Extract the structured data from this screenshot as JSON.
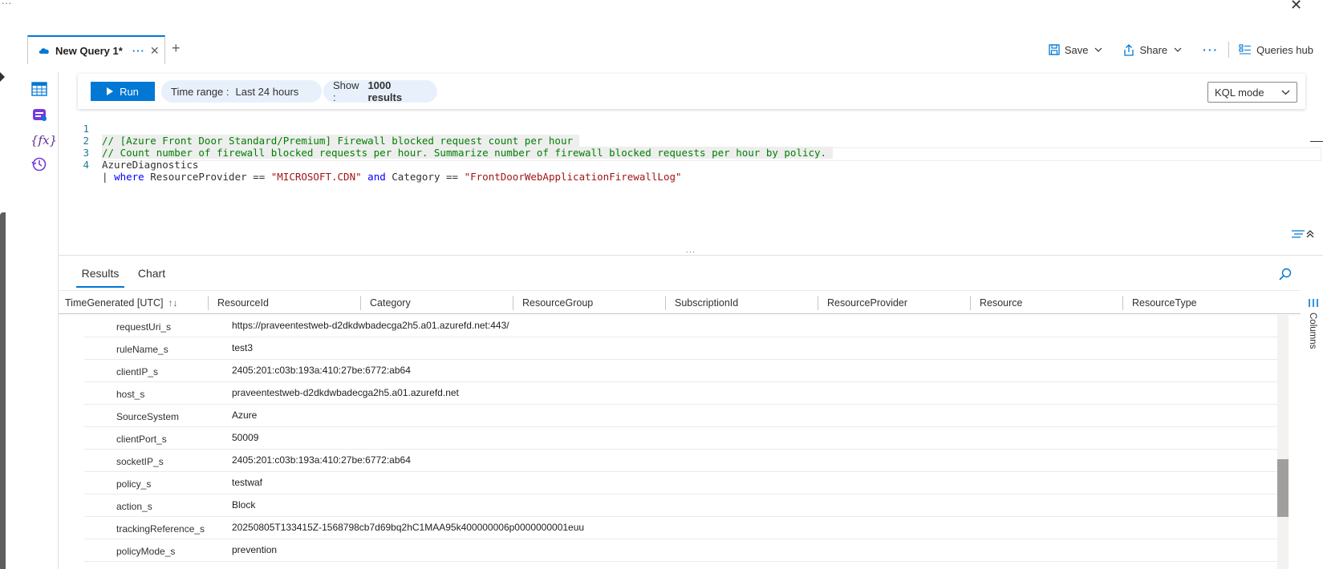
{
  "window": {
    "top_dots": "...",
    "close_glyph": "✕"
  },
  "tabs": [
    {
      "label": "New Query 1*",
      "more": "···",
      "close": "✕"
    }
  ],
  "add_tab": "+",
  "toolbar": {
    "save_label": "Save",
    "share_label": "Share",
    "more": "···",
    "queries_hub_label": "Queries hub"
  },
  "query_toolbar": {
    "run_label": "Run",
    "time_range_label": "Time range :",
    "time_range_value": "Last 24 hours",
    "show_label": "Show :",
    "show_value": "1000 results",
    "mode_value": "KQL mode"
  },
  "rail_icons": [
    "tables-icon",
    "queries-icon",
    "functions-icon",
    "history-icon"
  ],
  "rail_fx": "{fx}",
  "editor": {
    "lines": [
      {
        "num": "1",
        "text": "// [Azure Front Door Standard/Premium] Firewall blocked request count per hour "
      },
      {
        "num": "2",
        "text": "// Count number of firewall blocked requests per hour. Summarize number of firewall blocked requests per hour by policy. "
      },
      {
        "num": "3",
        "text": "AzureDiagnostics"
      },
      {
        "num": "4",
        "pipe": "| ",
        "kw1": "where",
        "mid1": " ResourceProvider == ",
        "str1": "\"MICROSOFT.CDN\"",
        "kw2": " and",
        "mid2": " Category == ",
        "str2": "\"FrontDoorWebApplicationFirewallLog\""
      }
    ]
  },
  "splitter": "···",
  "results_tabs": {
    "results_label": "Results",
    "chart_label": "Chart"
  },
  "columns": [
    "TimeGenerated [UTC]",
    "ResourceId",
    "Category",
    "ResourceGroup",
    "SubscriptionId",
    "ResourceProvider",
    "Resource",
    "ResourceType"
  ],
  "sort_glyph": "↑↓",
  "columns_panel_label": "Columns",
  "rows": [
    {
      "key": "requestUri_s",
      "value": "https://praveentestweb-d2dkdwbadecga2h5.a01.azurefd.net:443/"
    },
    {
      "key": "ruleName_s",
      "value": "test3"
    },
    {
      "key": "clientIP_s",
      "value": "2405:201:c03b:193a:410:27be:6772:ab64"
    },
    {
      "key": "host_s",
      "value": "praveentestweb-d2dkdwbadecga2h5.a01.azurefd.net"
    },
    {
      "key": "SourceSystem",
      "value": "Azure"
    },
    {
      "key": "clientPort_s",
      "value": "50009"
    },
    {
      "key": "socketIP_s",
      "value": "2405:201:c03b:193a:410:27be:6772:ab64"
    },
    {
      "key": "policy_s",
      "value": "testwaf"
    },
    {
      "key": "action_s",
      "value": "Block"
    },
    {
      "key": "trackingReference_s",
      "value": "20250805T133415Z-1568798cb7d69bq2hC1MAA95k400000006p0000000001euu"
    },
    {
      "key": "policyMode_s",
      "value": "prevention"
    }
  ],
  "colors": {
    "accent": "#0078d4",
    "comment": "#008000",
    "keyword": "#0000ff",
    "string": "#a31515"
  }
}
